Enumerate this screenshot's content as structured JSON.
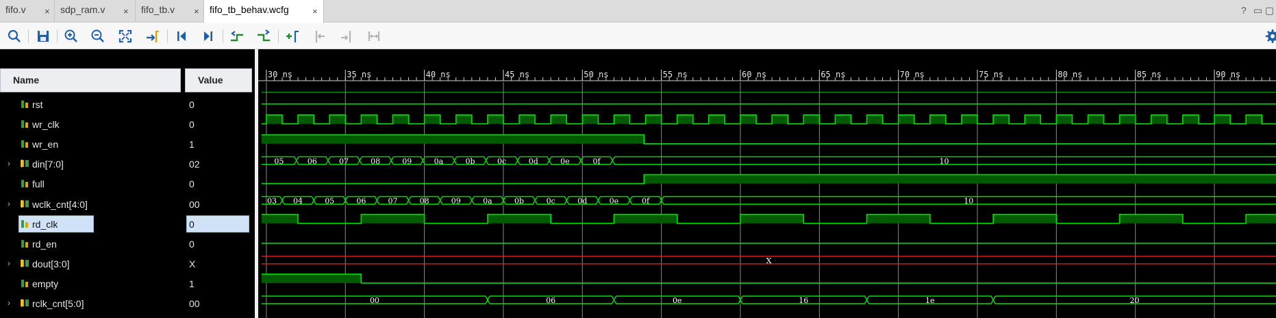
{
  "tabs": [
    {
      "label": "fifo.v",
      "active": false
    },
    {
      "label": "sdp_ram.v",
      "active": false
    },
    {
      "label": "fifo_tb.v",
      "active": false
    },
    {
      "label": "fifo_tb_behav.wcfg",
      "active": true
    }
  ],
  "tab_close_glyph": "×",
  "window_controls": [
    "?",
    "▭",
    "▢"
  ],
  "toolbar_icons": [
    "search-icon",
    "save-icon",
    "zoom-in-icon",
    "zoom-out-icon",
    "zoom-fit-icon",
    "go-to-cursor-icon",
    "go-to-start-icon",
    "go-to-end-icon",
    "previous-transition-icon",
    "next-transition-icon",
    "add-marker-icon",
    "previous-marker-icon",
    "next-marker-icon",
    "swap-cursors-icon",
    "settings-gear-icon"
  ],
  "columns": {
    "name": "Name",
    "value": "Value"
  },
  "signals": [
    {
      "name": "rst",
      "value": "0",
      "bus": false,
      "selected": false
    },
    {
      "name": "wr_clk",
      "value": "0",
      "bus": false,
      "selected": false
    },
    {
      "name": "wr_en",
      "value": "1",
      "bus": false,
      "selected": false
    },
    {
      "name": "din[7:0]",
      "value": "02",
      "bus": true,
      "selected": false
    },
    {
      "name": "full",
      "value": "0",
      "bus": false,
      "selected": false
    },
    {
      "name": "wclk_cnt[4:0]",
      "value": "00",
      "bus": true,
      "selected": false
    },
    {
      "name": "rd_clk",
      "value": "0",
      "bus": false,
      "selected": true
    },
    {
      "name": "rd_en",
      "value": "0",
      "bus": false,
      "selected": false
    },
    {
      "name": "dout[3:0]",
      "value": "X",
      "bus": true,
      "selected": false
    },
    {
      "name": "empty",
      "value": "1",
      "bus": false,
      "selected": false
    },
    {
      "name": "rclk_cnt[5:0]",
      "value": "00",
      "bus": true,
      "selected": false
    }
  ],
  "timeline": {
    "unit": "ns",
    "view_start_ns": 29.7,
    "view_end_ns": 93.9,
    "major_tick_step_ns": 5,
    "minor_tick_step_ns": 0.5,
    "labels": [
      "30 ns",
      "35 ns",
      "40 ns",
      "45 ns",
      "50 ns",
      "55 ns",
      "60 ns",
      "65 ns",
      "70 ns",
      "75 ns",
      "80 ns",
      "85 ns",
      "90 ns"
    ]
  },
  "waves": {
    "rst": {
      "type": "bit",
      "initial": 0,
      "transitions": []
    },
    "wr_clk": {
      "type": "clock",
      "period_ns": 2,
      "first_rise_ns": 30,
      "duty": 0.5
    },
    "wr_en": {
      "type": "bit",
      "initial": 1,
      "transitions": [
        {
          "t": 53.9,
          "v": 0
        }
      ]
    },
    "din": {
      "type": "bus",
      "segments": [
        {
          "t": 29.7,
          "label": "05"
        },
        {
          "t": 31.9,
          "label": "06"
        },
        {
          "t": 33.9,
          "label": "07"
        },
        {
          "t": 35.9,
          "label": "08"
        },
        {
          "t": 37.9,
          "label": "09"
        },
        {
          "t": 39.9,
          "label": "0a"
        },
        {
          "t": 41.9,
          "label": "0b"
        },
        {
          "t": 43.9,
          "label": "0c"
        },
        {
          "t": 45.9,
          "label": "0d"
        },
        {
          "t": 47.9,
          "label": "0e"
        },
        {
          "t": 49.9,
          "label": "0f"
        },
        {
          "t": 51.9,
          "label": "10"
        }
      ]
    },
    "full": {
      "type": "bit",
      "initial": 0,
      "transitions": [
        {
          "t": 53.9,
          "v": 1
        }
      ]
    },
    "wclk_cnt": {
      "type": "bus",
      "segments": [
        {
          "t": 29.7,
          "label": "03"
        },
        {
          "t": 31.0,
          "label": "04"
        },
        {
          "t": 33.0,
          "label": "05"
        },
        {
          "t": 35.0,
          "label": "06"
        },
        {
          "t": 37.0,
          "label": "07"
        },
        {
          "t": 39.0,
          "label": "08"
        },
        {
          "t": 41.0,
          "label": "09"
        },
        {
          "t": 43.0,
          "label": "0a"
        },
        {
          "t": 45.0,
          "label": "0b"
        },
        {
          "t": 47.0,
          "label": "0c"
        },
        {
          "t": 49.0,
          "label": "0d"
        },
        {
          "t": 51.0,
          "label": "0e"
        },
        {
          "t": 53.0,
          "label": "0f"
        },
        {
          "t": 55.0,
          "label": "10"
        }
      ]
    },
    "rd_clk": {
      "type": "clock",
      "period_ns": 8,
      "first_rise_ns": 28,
      "duty": 0.5
    },
    "rd_en": {
      "type": "bit",
      "initial": 0,
      "transitions": []
    },
    "dout": {
      "type": "unknown",
      "label": "X"
    },
    "empty": {
      "type": "bit",
      "initial": 1,
      "transitions": [
        {
          "t": 36.0,
          "v": 0
        }
      ]
    },
    "rclk_cnt": {
      "type": "bus",
      "segments": [
        {
          "t": 29.7,
          "label": "00"
        },
        {
          "t": 44.0,
          "label": "06"
        },
        {
          "t": 52.0,
          "label": "0e"
        },
        {
          "t": 60.0,
          "label": "16"
        },
        {
          "t": 68.0,
          "label": "1e"
        },
        {
          "t": 76.0,
          "label": "20"
        }
      ]
    }
  },
  "colors": {
    "wave": "#00e000",
    "wave_fill": "#005a00",
    "unknown": "#e02020",
    "grid": "#8a8a8a",
    "ruler_text": "#e6e6e6",
    "bus_text": "#ffffff"
  }
}
